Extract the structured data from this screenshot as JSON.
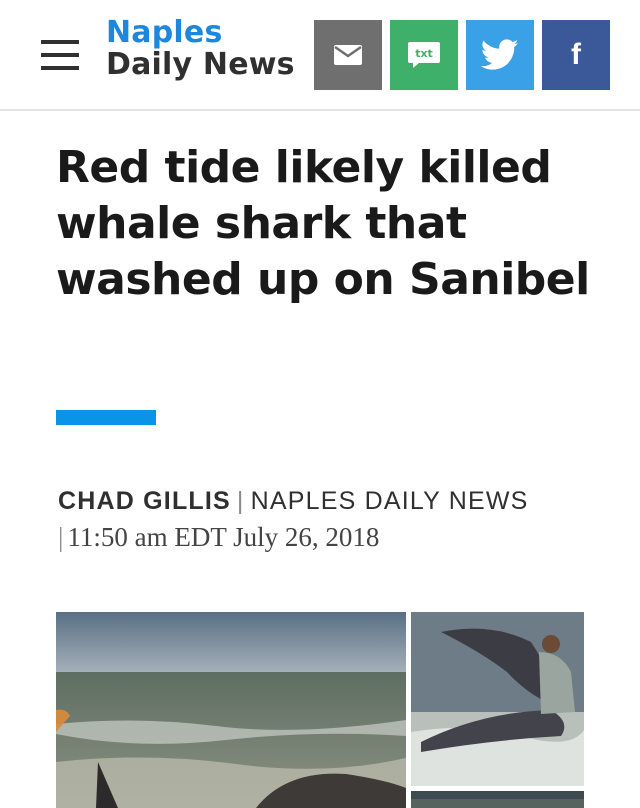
{
  "colors": {
    "brand_blue": "#1b88e0",
    "email": "#6f6f6f",
    "sms": "#3fb06a",
    "twitter": "#3ba1e6",
    "facebook": "#3b5998",
    "accent_bar": "#0a94e8"
  },
  "header": {
    "menu_icon": "hamburger-menu-icon",
    "brand": {
      "line1": "Naples",
      "line2": "Daily News"
    },
    "share": {
      "email_icon": "envelope-icon",
      "sms_icon_label": "txt",
      "twitter_icon": "twitter-bird-icon",
      "facebook_icon": "f"
    }
  },
  "article": {
    "headline": "Red tide likely killed whale shark that washed up on Sanibel",
    "byline": {
      "author": "CHAD GILLIS",
      "outlet": "NAPLES DAILY NEWS",
      "separator": "|",
      "timestamp": "11:50 am EDT July 26, 2018"
    },
    "photos": {
      "main": "whale-shark-on-beach-photo",
      "side1": "man-with-whale-shark-tail-photo",
      "side2": "whale-shark-photo"
    }
  }
}
